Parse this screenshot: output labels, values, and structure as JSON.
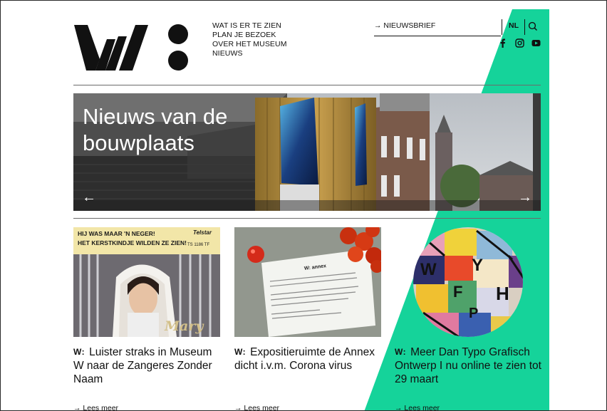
{
  "header": {
    "logo": "W:",
    "nav": [
      "WAT IS ER TE ZIEN",
      "PLAN JE BEZOEK",
      "OVER HET MUSEUM",
      "NIEUWS"
    ],
    "newsletter": "→ NIEUWSBRIEF",
    "language": "NL",
    "social_icons": [
      "facebook-icon",
      "instagram-icon",
      "youtube-icon"
    ]
  },
  "hero": {
    "title": "Nieuws van de bouwplaats",
    "prev_arrow": "←",
    "next_arrow": "→"
  },
  "cards": [
    {
      "mark": "W:",
      "title": "Luister straks in Museum W naar de Zangeres Zonder Naam",
      "read_more": "→ Lees meer",
      "image_text": {
        "line1": "HIJ WAS MAAR 'N NEGER!",
        "line2": "HET KERSTKINDJE WILDEN ZE ZIEN!",
        "brand": "Telstar",
        "code": "TS 1186 TF",
        "name": "Mary"
      }
    },
    {
      "mark": "W:",
      "title": "Expositieruimte de Annex dicht i.v.m. Corona virus",
      "read_more": "→ Lees meer",
      "image_text": {
        "sign_logo": "W: annex"
      }
    },
    {
      "mark": "W:",
      "title": "Meer Dan Typo Grafisch Ontwerp I nu online te zien tot 29 maart",
      "read_more": "→ Lees meer",
      "image_text": {
        "letters": [
          "W",
          "Y",
          "F",
          "H",
          "P"
        ]
      }
    }
  ],
  "colors": {
    "accent": "#15d39a",
    "text": "#111111",
    "rule": "#6b6b6b"
  }
}
